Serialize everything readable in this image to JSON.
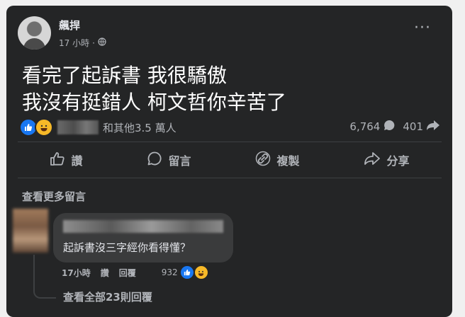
{
  "post": {
    "author": "飆捍",
    "time": "17 小時",
    "separator": "·",
    "lines": [
      "看完了起訴書 我很驕傲",
      "我沒有挺錯人 柯文哲你辛苦了"
    ],
    "reactions_text": "和其他3.5 萬人",
    "comment_count": "6,764",
    "share_count": "401"
  },
  "actions": {
    "like": "讚",
    "comment": "留言",
    "copy": "複製",
    "share": "分享"
  },
  "comments": {
    "see_more": "查看更多留言",
    "first": {
      "text": "起訴書沒三字經你看得懂？",
      "time": "17小時",
      "like": "讚",
      "reply": "回覆",
      "reaction_count": "932",
      "view_replies": "查看全部23則回覆"
    }
  },
  "icons": {
    "globe": "globe-icon",
    "more": "more-options-icon",
    "like": "thumbs-up-icon",
    "comment": "comment-icon",
    "copy": "link-icon",
    "share": "share-arrow-icon",
    "comment_count": "comment-bubble-icon",
    "share_count": "share-icon"
  },
  "colors": {
    "card": "#242526",
    "text": "#e4e6eb",
    "secondary": "#b0b3b8",
    "like_blue": "#1877f2",
    "haha_yellow": "#f7b928"
  }
}
